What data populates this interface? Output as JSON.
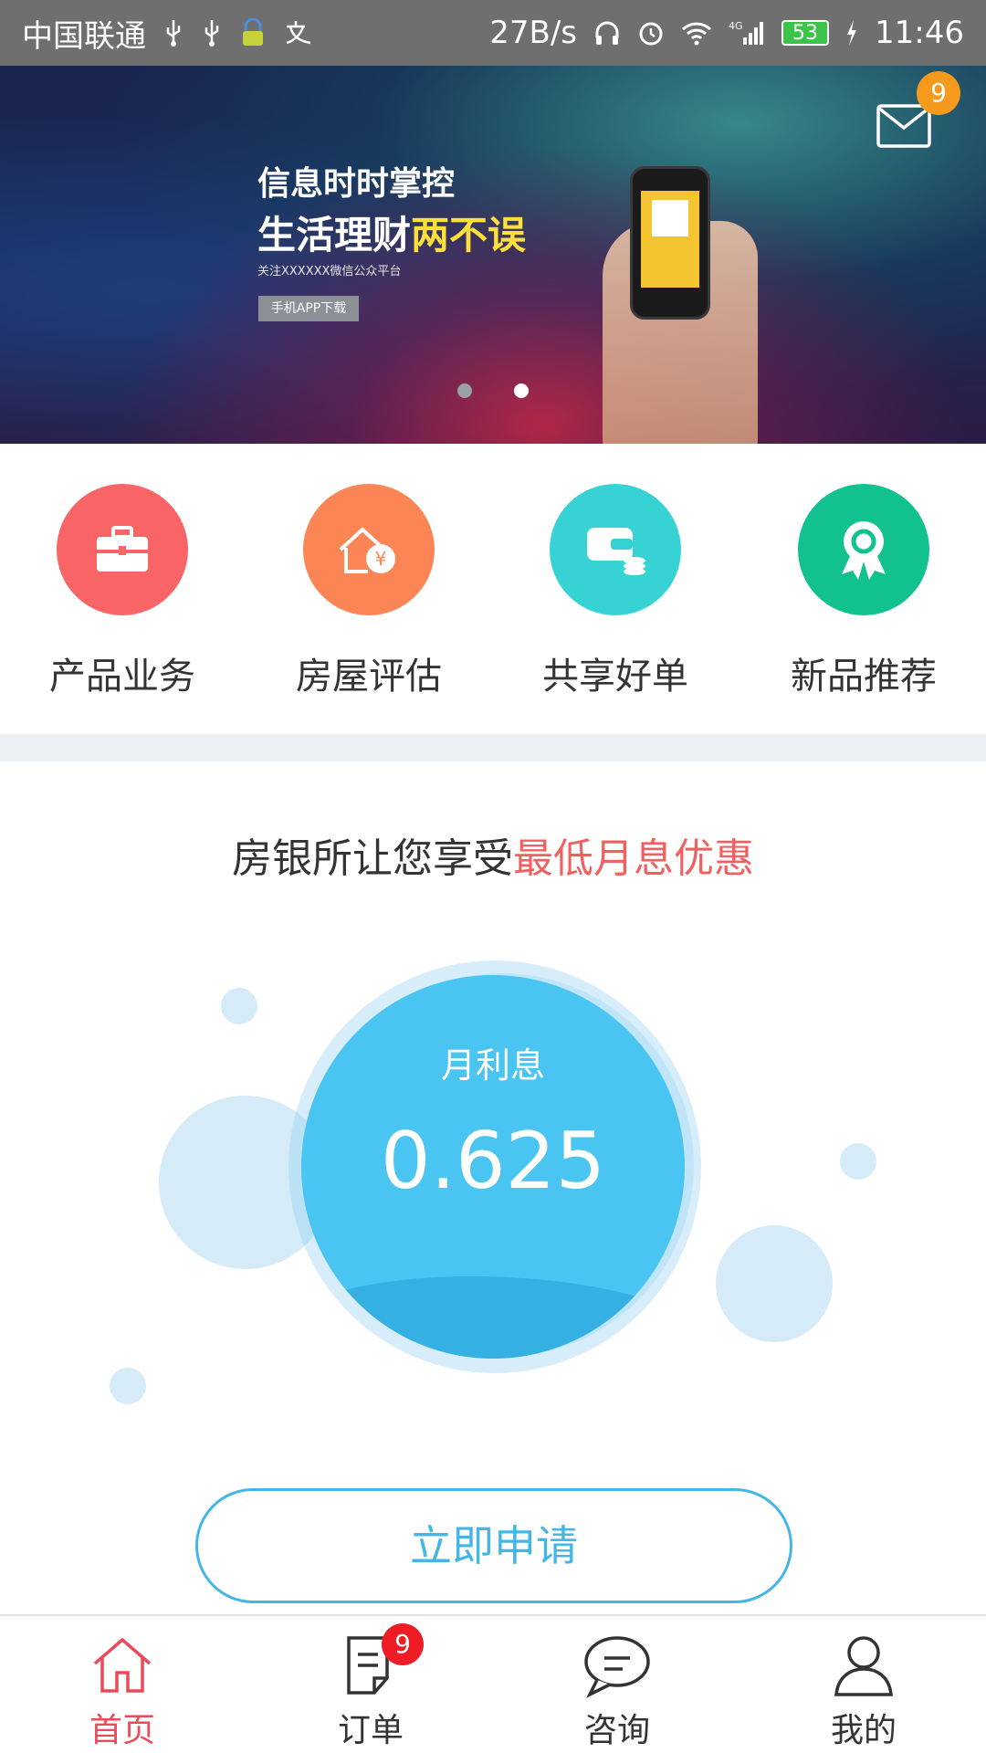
{
  "status_bar": {
    "carrier": "中国联通",
    "network_speed": "27B/s",
    "battery": "53",
    "time": "11:46"
  },
  "banner": {
    "title_line1": "信息时时掌控",
    "title_line2_a": "生活理财",
    "title_line2_b": "两不误",
    "subtitle": "关注XXXXXX微信公众平台",
    "button_label": "手机APP下载",
    "message_badge": "9",
    "slide_count": 2,
    "active_slide": 2
  },
  "quick_nav": [
    {
      "label": "产品业务",
      "color": "#f96567",
      "icon": "briefcase-icon"
    },
    {
      "label": "房屋评估",
      "color": "#fc8555",
      "icon": "house-yen-icon"
    },
    {
      "label": "共享好单",
      "color": "#37d2d3",
      "icon": "wallet-coins-icon"
    },
    {
      "label": "新品推荐",
      "color": "#11c190",
      "icon": "award-ribbon-icon"
    }
  ],
  "promo": {
    "headline_plain": "房银所让您享受",
    "headline_highlight": "最低月息优惠",
    "rate_label": "月利息",
    "rate_value": "0.625",
    "apply_label": "立即申请"
  },
  "tabbar": [
    {
      "label": "首页",
      "icon": "home-icon",
      "active": true
    },
    {
      "label": "订单",
      "icon": "order-icon",
      "badge": "9"
    },
    {
      "label": "咨询",
      "icon": "chat-icon"
    },
    {
      "label": "我的",
      "icon": "user-icon"
    }
  ],
  "colors": {
    "accent_red": "#e94c58",
    "highlight_red": "#f06060",
    "sky_blue": "#4ac4f0",
    "badge_orange": "#f69a1d",
    "badge_red": "#ee1c25"
  }
}
